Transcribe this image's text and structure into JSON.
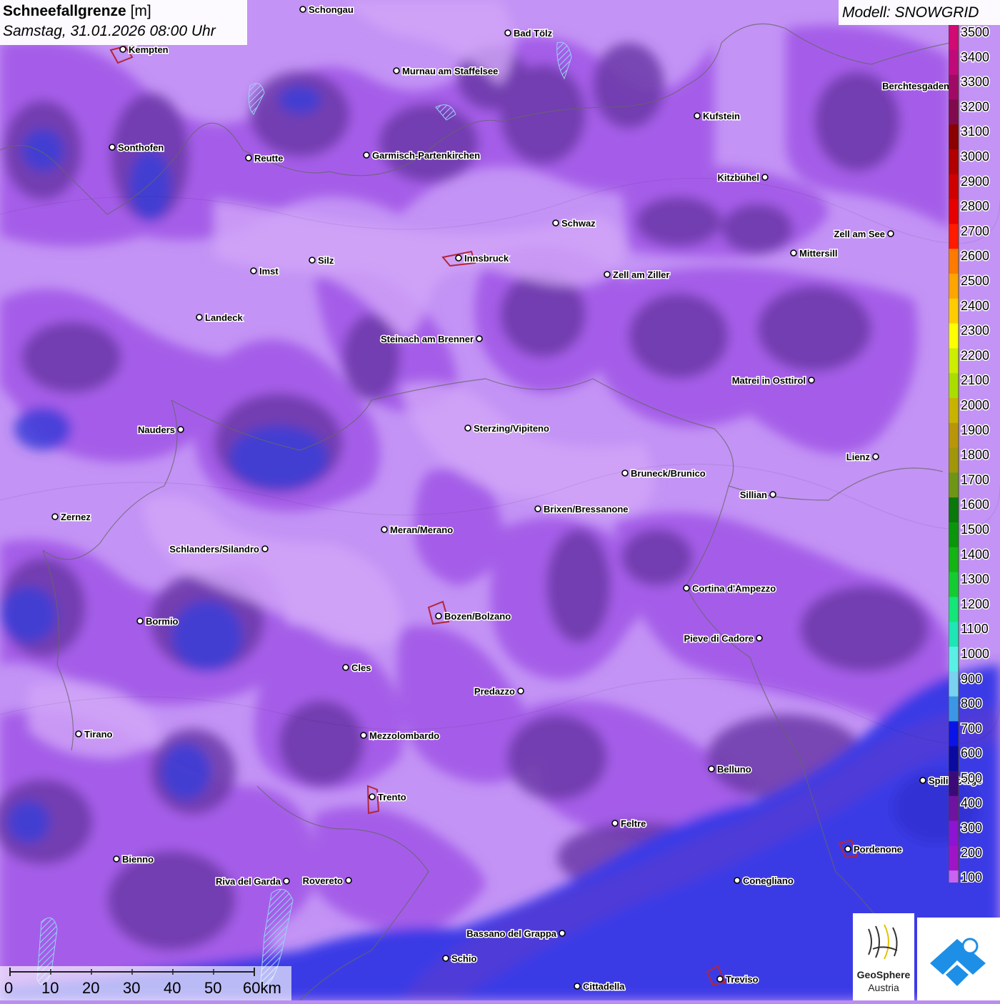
{
  "title": {
    "main": "Schneefallgrenze",
    "unit": "[m]",
    "datetime": "Samstag, 31.01.2026 08:00 Uhr"
  },
  "model": "Modell: SNOWGRID",
  "legend": {
    "ticks": [
      "3500",
      "3400",
      "3300",
      "3200",
      "3100",
      "3000",
      "2900",
      "2800",
      "2700",
      "2600",
      "2500",
      "2400",
      "2300",
      "2200",
      "2100",
      "2000",
      "1900",
      "1800",
      "1700",
      "1600",
      "1500",
      "1400",
      "1300",
      "1200",
      "1100",
      "1000",
      "900",
      "800",
      "700",
      "600",
      "500",
      "400",
      "300",
      "200",
      "100"
    ],
    "colors": [
      "#d10a74",
      "#c00a7a",
      "#a00a66",
      "#800a4c",
      "#8b0000",
      "#b00000",
      "#d00000",
      "#e80000",
      "#ff1a00",
      "#ff7a00",
      "#ffa500",
      "#ffcc00",
      "#ffff00",
      "#ccee00",
      "#aadd00",
      "#c8b400",
      "#b8960a",
      "#a0960a",
      "#6e9614",
      "#0a780a",
      "#0a960a",
      "#14b414",
      "#14cc32",
      "#14e678",
      "#1ee6b4",
      "#5af0e6",
      "#78d2f0",
      "#3c96e6",
      "#0a14e6",
      "#0a0aa0",
      "#3c0a78",
      "#6e14a0",
      "#8c14d2",
      "#a014c8",
      "#c864f0"
    ]
  },
  "cities": [
    {
      "name": "Schongau"
    },
    {
      "name": "Kempten"
    },
    {
      "name": "Bad Tölz"
    },
    {
      "name": "Murnau am Staffelsee"
    },
    {
      "name": "Berchtesgaden"
    },
    {
      "name": "Kufstein"
    },
    {
      "name": "Sonthofen"
    },
    {
      "name": "Reutte"
    },
    {
      "name": "Garmisch-Partenkirchen"
    },
    {
      "name": "Kitzbühel"
    },
    {
      "name": "Schwaz"
    },
    {
      "name": "Zell am See"
    },
    {
      "name": "Mittersill"
    },
    {
      "name": "Innsbruck"
    },
    {
      "name": "Silz"
    },
    {
      "name": "Imst"
    },
    {
      "name": "Zell am Ziller"
    },
    {
      "name": "Landeck"
    },
    {
      "name": "Steinach am Brenner"
    },
    {
      "name": "Matrei in Osttirol"
    },
    {
      "name": "Nauders"
    },
    {
      "name": "Sterzing/Vipiteno"
    },
    {
      "name": "Lienz"
    },
    {
      "name": "Bruneck/Brunico"
    },
    {
      "name": "Sillian"
    },
    {
      "name": "Zernez"
    },
    {
      "name": "Brixen/Bressanone"
    },
    {
      "name": "Meran/Merano"
    },
    {
      "name": "Schlanders/Silandro"
    },
    {
      "name": "Cortina d'Ampezzo"
    },
    {
      "name": "Bormio"
    },
    {
      "name": "Bozen/Bolzano"
    },
    {
      "name": "Pieve di Cadore"
    },
    {
      "name": "Cles"
    },
    {
      "name": "Predazzo"
    },
    {
      "name": "Tirano"
    },
    {
      "name": "Mezzolombardo"
    },
    {
      "name": "Belluno"
    },
    {
      "name": "Spilimbergo"
    },
    {
      "name": "Trento"
    },
    {
      "name": "Feltre"
    },
    {
      "name": "Pordenone"
    },
    {
      "name": "Bienno"
    },
    {
      "name": "Riva del Garda"
    },
    {
      "name": "Rovereto"
    },
    {
      "name": "Conegliano"
    },
    {
      "name": "Bassano del Grappa"
    },
    {
      "name": "Schio"
    },
    {
      "name": "Treviso"
    },
    {
      "name": "Cittadella"
    }
  ],
  "scale": {
    "ticks": [
      "0",
      "10",
      "20",
      "30",
      "40",
      "50",
      "60km"
    ]
  },
  "logos": {
    "geosphere_line1": "GeoSphere",
    "geosphere_line2": "Austria"
  }
}
